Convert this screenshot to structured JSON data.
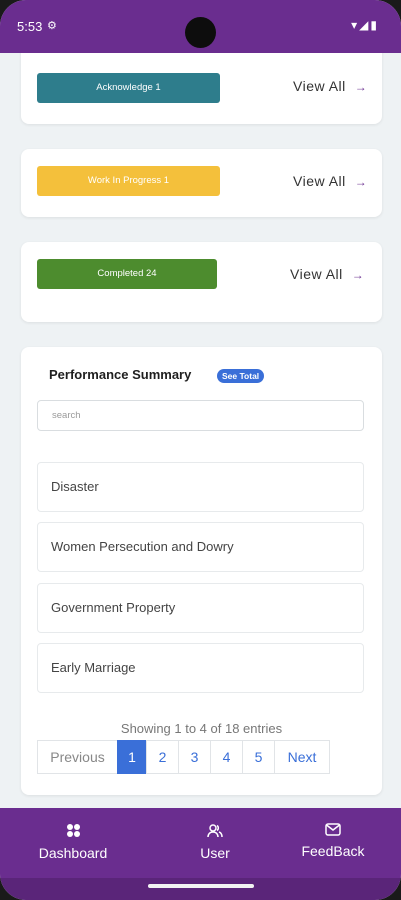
{
  "status_bar": {
    "time": "5:53",
    "settings_icon": "gear-icon",
    "right_icons": [
      "wifi-icon",
      "signal-icon",
      "battery-icon"
    ]
  },
  "colors": {
    "primary_purple": "#6a2d8f",
    "acknowledge": "#2e7d8c",
    "work_in_progress": "#f4c03b",
    "completed": "#4d8c2e",
    "link_blue": "#3a6fd8"
  },
  "status_cards": [
    {
      "label": "Acknowledge 1",
      "view_all": "View All"
    },
    {
      "label": "Work In Progress 1",
      "view_all": "View All"
    },
    {
      "label": "Completed 24",
      "view_all": "View All"
    }
  ],
  "performance": {
    "title": "Performance Summary",
    "see_total": "See Total",
    "search_placeholder": "search",
    "items": [
      "Disaster",
      "Women Persecution and Dowry",
      "Government Property",
      "Early Marriage"
    ],
    "entries_text": "Showing 1 to 4 of 18 entries",
    "pagination": {
      "previous": "Previous",
      "pages": [
        "1",
        "2",
        "3",
        "4",
        "5"
      ],
      "active_page": "1",
      "next": "Next"
    }
  },
  "bottom_nav": [
    {
      "label": "Dashboard",
      "icon": "dashboard-grid-icon"
    },
    {
      "label": "User",
      "icon": "users-icon"
    },
    {
      "label": "FeedBack",
      "icon": "envelope-icon"
    }
  ]
}
